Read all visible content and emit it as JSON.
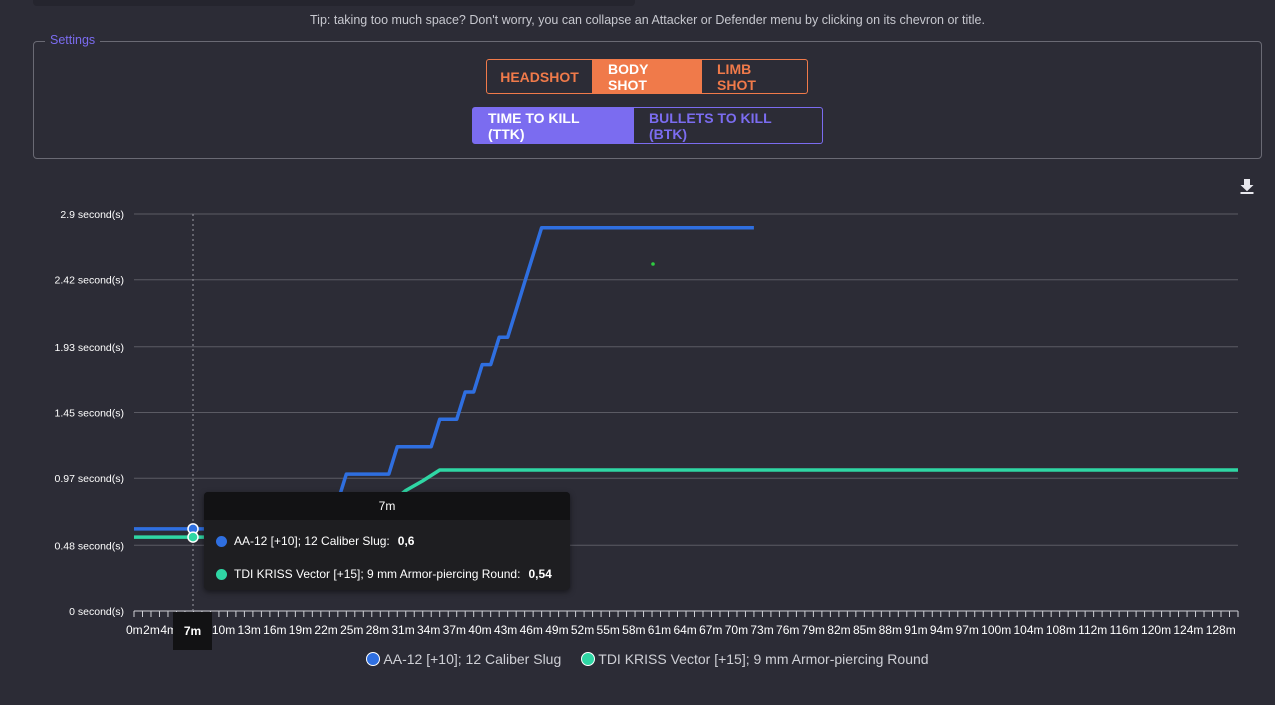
{
  "tip": "Tip: taking too much space? Don't worry, you can collapse an Attacker or Defender menu by clicking on its chevron or title.",
  "settings": {
    "legend": "Settings",
    "shot_buttons": [
      {
        "label": "HEADSHOT",
        "active": false
      },
      {
        "label": "BODY SHOT",
        "active": true
      },
      {
        "label": "LIMB SHOT",
        "active": false
      }
    ],
    "mode_buttons": [
      {
        "label": "TIME TO KILL (TTK)",
        "active": true
      },
      {
        "label": "BULLETS TO KILL (BTK)",
        "active": false
      }
    ]
  },
  "colors": {
    "shot_accent": "#f07a4a",
    "mode_accent": "#7b6cf0",
    "series_1": "#2f6fe0",
    "series_2": "#2fd6a4"
  },
  "icons": {
    "download": "download-icon"
  },
  "tooltip": {
    "title": "7m",
    "rows": [
      {
        "label": "AA-12 [+10]; 12 Caliber Slug:",
        "value": "0,6"
      },
      {
        "label": "TDI KRISS Vector [+15]; 9 mm Armor-piercing Round:",
        "value": "0,54"
      }
    ]
  },
  "cursor_label": "7m",
  "chart_data": {
    "type": "line",
    "y_ticks": [
      "0 second(s)",
      "0.48 second(s)",
      "0.97 second(s)",
      "1.45 second(s)",
      "1.93 second(s)",
      "2.42 second(s)",
      "2.9 second(s)"
    ],
    "y_tick_values": [
      0,
      0.48,
      0.97,
      1.45,
      1.93,
      2.42,
      2.9
    ],
    "ylim": [
      0,
      2.9
    ],
    "xlim": [
      0,
      130
    ],
    "x_ticks": [
      "0m",
      "2m",
      "4m",
      "6m",
      "8m",
      "10m",
      "13m",
      "16m",
      "19m",
      "22m",
      "25m",
      "28m",
      "31m",
      "34m",
      "37m",
      "40m",
      "43m",
      "46m",
      "49m",
      "52m",
      "55m",
      "58m",
      "61m",
      "64m",
      "67m",
      "70m",
      "73m",
      "76m",
      "79m",
      "82m",
      "85m",
      "88m",
      "91m",
      "94m",
      "97m",
      "100m",
      "104m",
      "108m",
      "112m",
      "116m",
      "120m",
      "124m",
      "128m"
    ],
    "grid": true,
    "legend_position": "bottom",
    "cursor_x": 7,
    "series": [
      {
        "name": "AA-12 [+10]; 12 Caliber Slug",
        "x": [
          0,
          7,
          8,
          14,
          16,
          22,
          24,
          25,
          26,
          30,
          31,
          35,
          36,
          38,
          39,
          40,
          41,
          42,
          43,
          44,
          45,
          46,
          47,
          48,
          73
        ],
        "y": [
          0.6,
          0.6,
          0.6,
          0.6,
          0.8,
          0.8,
          0.8,
          1.0,
          1.0,
          1.0,
          1.2,
          1.2,
          1.4,
          1.4,
          1.6,
          1.6,
          1.8,
          1.8,
          2.0,
          2.0,
          2.2,
          2.4,
          2.6,
          2.8,
          2.8
        ]
      },
      {
        "name": "TDI KRISS Vector [+15]; 9 mm Armor-piercing Round",
        "x": [
          0,
          7,
          10,
          14,
          15,
          30,
          32,
          34,
          36,
          37,
          130
        ],
        "y": [
          0.54,
          0.54,
          0.54,
          0.6,
          0.78,
          0.78,
          0.88,
          0.95,
          1.03,
          1.03,
          1.03
        ]
      }
    ]
  }
}
